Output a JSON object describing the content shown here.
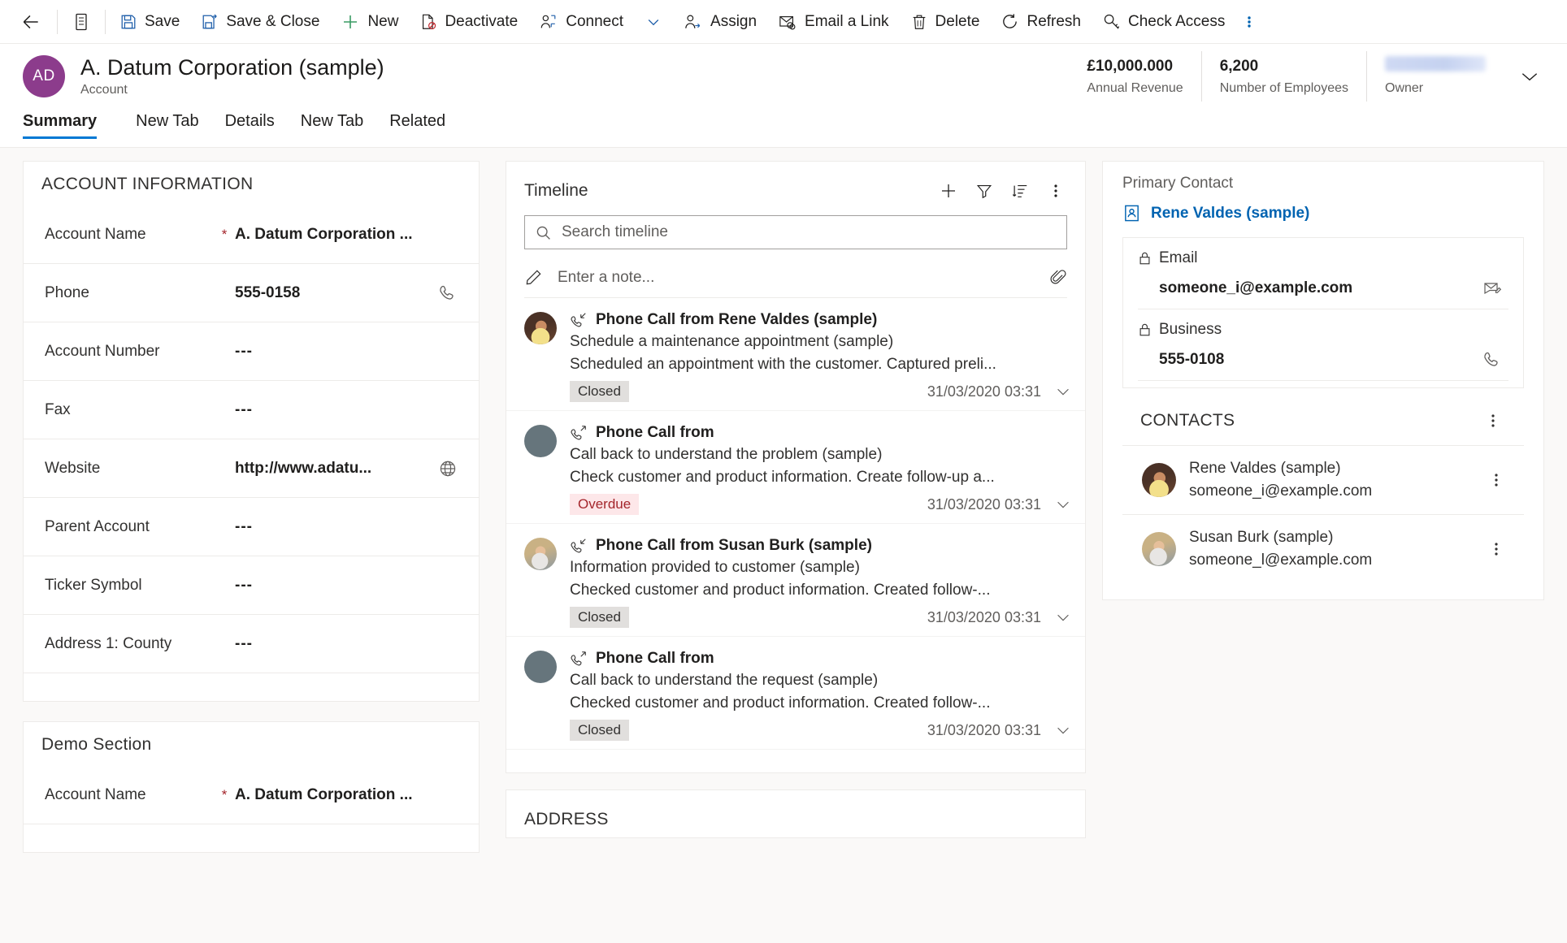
{
  "commandbar": {
    "back_label": "Back",
    "form_selector_label": "Form selector",
    "items": [
      {
        "id": "save",
        "label": "Save",
        "icon": "save-icon"
      },
      {
        "id": "save-close",
        "label": "Save & Close",
        "icon": "save-close-icon"
      },
      {
        "id": "new",
        "label": "New",
        "icon": "plus-icon"
      },
      {
        "id": "deactivate",
        "label": "Deactivate",
        "icon": "deactivate-icon"
      },
      {
        "id": "connect",
        "label": "Connect",
        "icon": "connect-icon"
      },
      {
        "id": "assign",
        "label": "Assign",
        "icon": "assign-icon"
      },
      {
        "id": "email-link",
        "label": "Email a Link",
        "icon": "email-link-icon"
      },
      {
        "id": "delete",
        "label": "Delete",
        "icon": "trash-icon"
      },
      {
        "id": "refresh",
        "label": "Refresh",
        "icon": "refresh-icon"
      },
      {
        "id": "check-access",
        "label": "Check Access",
        "icon": "key-icon"
      }
    ],
    "overflow_label": "More commands"
  },
  "record_header": {
    "avatar_initials": "AD",
    "title": "A. Datum Corporation (sample)",
    "entity": "Account",
    "stats": [
      {
        "id": "annual-revenue",
        "value": "£10,000.000",
        "label": "Annual Revenue"
      },
      {
        "id": "number-of-employees",
        "value": "6,200",
        "label": "Number of Employees"
      },
      {
        "id": "owner",
        "value": "",
        "label": "Owner"
      }
    ],
    "expand_label": "Expand header"
  },
  "tabs": [
    {
      "id": "summary",
      "label": "Summary",
      "active": true
    },
    {
      "id": "new-tab-1",
      "label": "New Tab",
      "active": false
    },
    {
      "id": "details",
      "label": "Details",
      "active": false
    },
    {
      "id": "new-tab-2",
      "label": "New Tab",
      "active": false
    },
    {
      "id": "related",
      "label": "Related",
      "active": false
    }
  ],
  "account_information": {
    "title": "ACCOUNT INFORMATION",
    "fields": [
      {
        "label": "Account Name",
        "value": "A. Datum Corporation ...",
        "required": true,
        "action": "none"
      },
      {
        "label": "Phone",
        "value": "555-0158",
        "required": false,
        "action": "phone-icon"
      },
      {
        "label": "Account Number",
        "value": "---",
        "required": false,
        "action": "none"
      },
      {
        "label": "Fax",
        "value": "---",
        "required": false,
        "action": "none"
      },
      {
        "label": "Website",
        "value": "http://www.adatu...",
        "required": false,
        "action": "globe-icon"
      },
      {
        "label": "Parent Account",
        "value": "---",
        "required": false,
        "action": "none"
      },
      {
        "label": "Ticker Symbol",
        "value": "---",
        "required": false,
        "action": "none"
      },
      {
        "label": "Address 1: County",
        "value": "---",
        "required": false,
        "action": "none"
      }
    ]
  },
  "demo_section": {
    "title": "Demo Section",
    "fields": [
      {
        "label": "Account Name",
        "value": "A. Datum Corporation ...",
        "required": true,
        "action": "none"
      }
    ]
  },
  "timeline": {
    "title": "Timeline",
    "actions": [
      {
        "id": "create-record",
        "label": "Create a timeline record",
        "icon": "plus-icon"
      },
      {
        "id": "filter",
        "label": "Filter timeline",
        "icon": "filter-icon"
      },
      {
        "id": "sort",
        "label": "Sort timeline",
        "icon": "sort-icon"
      },
      {
        "id": "more",
        "label": "More timeline commands",
        "icon": "more-vertical-icon"
      }
    ],
    "search_placeholder": "Search timeline",
    "note_placeholder": "Enter a note...",
    "note_attach_label": "Add attachment",
    "items": [
      {
        "id": "item-1",
        "avatar": "photo-rene",
        "icon": "phone-incoming-icon",
        "title": "Phone Call from Rene Valdes (sample)",
        "subject": "Schedule a maintenance appointment (sample)",
        "description": "Scheduled an appointment with the customer. Captured preli...",
        "status": "Closed",
        "status_kind": "closed",
        "date": "31/03/2020 03:31"
      },
      {
        "id": "item-2",
        "avatar": "blank",
        "icon": "phone-outgoing-icon",
        "title": "Phone Call from",
        "subject": "Call back to understand the problem (sample)",
        "description": "Check customer and product information. Create follow-up a...",
        "status": "Overdue",
        "status_kind": "overdue",
        "date": "31/03/2020 03:31"
      },
      {
        "id": "item-3",
        "avatar": "photo-susan",
        "icon": "phone-incoming-icon",
        "title": "Phone Call from Susan Burk (sample)",
        "subject": "Information provided to customer (sample)",
        "description": "Checked customer and product information. Created follow-...",
        "status": "Closed",
        "status_kind": "closed",
        "date": "31/03/2020 03:31"
      },
      {
        "id": "item-4",
        "avatar": "blank",
        "icon": "phone-outgoing-icon",
        "title": "Phone Call from",
        "subject": "Call back to understand the request (sample)",
        "description": "Checked customer and product information. Created follow-...",
        "status": "Closed",
        "status_kind": "closed",
        "date": "31/03/2020 03:31"
      }
    ]
  },
  "address_section": {
    "title": "ADDRESS"
  },
  "primary_contact": {
    "label": "Primary Contact",
    "name": "Rene Valdes (sample)",
    "link_color": "#0063b1",
    "rows": [
      {
        "label": "Email",
        "value": "someone_i@example.com",
        "locked": true,
        "action": "email-icon"
      },
      {
        "label": "Business",
        "value": "555-0108",
        "locked": true,
        "action": "phone-icon"
      }
    ]
  },
  "contacts": {
    "title": "CONTACTS",
    "more_label": "More contacts commands",
    "items": [
      {
        "id": "contact-rene",
        "avatar": "photo-rene",
        "name": "Rene Valdes (sample)",
        "email": "someone_i@example.com"
      },
      {
        "id": "contact-susan",
        "avatar": "photo-susan",
        "name": "Susan Burk (sample)",
        "email": "someone_l@example.com"
      }
    ]
  },
  "colors": {
    "accent": "#0078d4",
    "link": "#0063b1",
    "avatar_purple": "#8C3C8C",
    "overdue_text": "#a4262c",
    "overdue_bg": "#fde7e9",
    "closed_bg": "#e1dfdd",
    "required_red": "#a4262c",
    "page_bg": "#faf9f8"
  }
}
